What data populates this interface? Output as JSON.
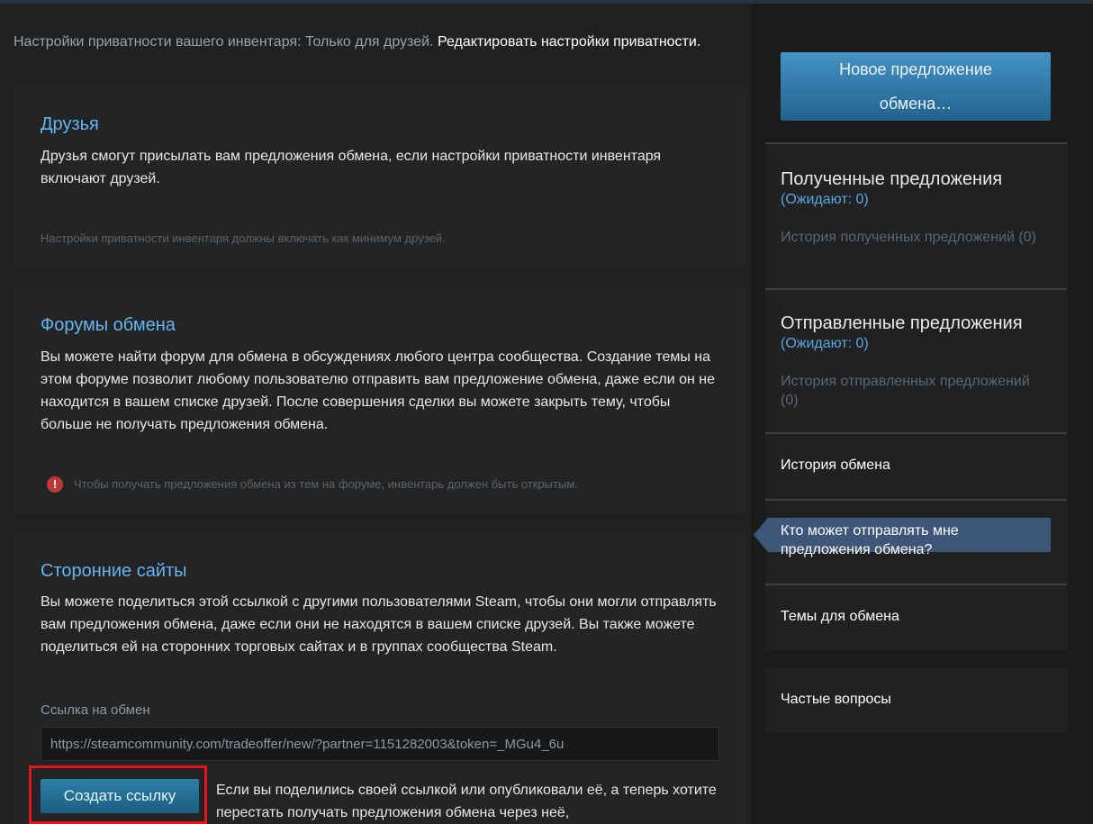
{
  "privacy": {
    "text": "Настройки приватности вашего инвентаря: Только для друзей.",
    "link": "Редактировать настройки приватности."
  },
  "friends": {
    "title": "Друзья",
    "body": "Друзья смогут присылать вам предложения обмена, если настройки приватности инвентаря включают друзей.",
    "note": "Настройки приватности инвентаря должны включать как минимум друзей."
  },
  "forums": {
    "title": "Форумы обмена",
    "body": "Вы можете найти форум для обмена в обсуждениях любого центра сообщества. Создание темы на этом форуме позволит любому пользователю отправить вам предложение обмена, даже если он не находится в вашем списке друзей. После совершения сделки вы можете закрыть тему, чтобы больше не получать предложения обмена.",
    "warning": "Чтобы получать предложения обмена из тем на форуме, инвентарь должен быть открытым.",
    "warning_icon": "!"
  },
  "third_party": {
    "title": "Сторонние сайты",
    "body": "Вы можете поделиться этой ссылкой с другими пользователями Steam, чтобы они могли отправлять вам предложения обмена, даже если они не находятся в вашем списке друзей. Вы также можете поделиться ей на сторонних торговых сайтах и в группах сообщества Steam.",
    "link_label": "Ссылка на обмен",
    "link_value": "https://steamcommunity.com/tradeoffer/new/?partner=1151282003&token=_MGu4_6u",
    "create_button": "Создать ссылку",
    "revoke_text": "Если вы поделились своей ссылкой или опубликовали её, а теперь хотите перестать получать предложения обмена через неё,"
  },
  "sidebar": {
    "new_offer_line1": "Новое предложение",
    "new_offer_line2": "обмена…",
    "received_title": "Полученные предложения",
    "received_pending": "(Ожидают: 0)",
    "received_history": "История полученных предложений (0)",
    "sent_title": "Отправленные предложения",
    "sent_pending": "(Ожидают: 0)",
    "sent_history": "История отправленных предложений (0)",
    "trade_history": "История обмена",
    "who_can_send": "Кто может отправлять мне предложения обмена?",
    "trade_topics": "Темы для обмена",
    "faq": "Частые вопросы"
  },
  "colors": {
    "accent_link": "#66b5f0",
    "button_blue": "#2d7fa8",
    "highlight_red": "#e8141c",
    "active_item": "#3e5678"
  }
}
